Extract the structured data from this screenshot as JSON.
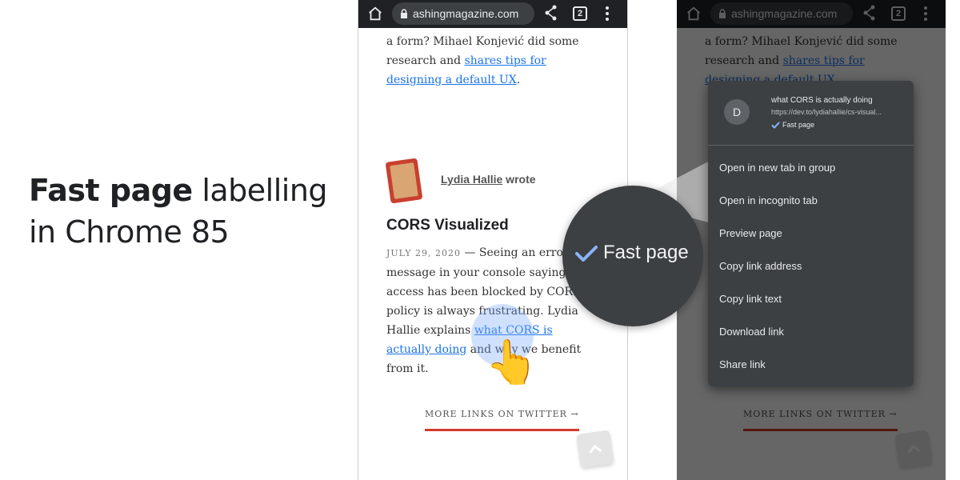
{
  "headline": {
    "bold": "Fast page",
    "rest1": "labelling",
    "rest2": "in Chrome 85"
  },
  "browser": {
    "url": "ashingmagazine.com",
    "tab_count": "2"
  },
  "article": {
    "p1_line1": "a form? Mihael Konjević did some",
    "p1_line2": "research and ",
    "p1_link": "shares tips for",
    "p1_link2": "designing a default UX",
    "p1_end": ".",
    "author_name": "Lydia Hallie",
    "author_suffix": " wrote",
    "title": "CORS Visualized",
    "date": "JULY 29, 2020",
    "body_part1": " — Seeing an error message in your console saying that access has been blocked by CORS policy is always frustrating. Lydia Hallie explains ",
    "body_link": "what CORS is actually doing",
    "body_end": " and why we benefit from it.",
    "more_links": "MORE LINKS ON TWITTER →"
  },
  "context_menu": {
    "avatar_letter": "D",
    "link_title": "what CORS is actually doing",
    "link_url": "https://dev.to/lydiahallie/cs-visual...",
    "fast_page": "Fast page",
    "items": [
      "Open in new tab in group",
      "Open in incognito tab",
      "Preview page",
      "Copy link address",
      "Copy link text",
      "Download link",
      "Share link"
    ]
  },
  "callout": {
    "label": "Fast page"
  },
  "colors": {
    "link": "#1a73e8",
    "accent_red": "#d33b2c",
    "check_blue": "#8ab4f8",
    "menu_bg": "#3c4043"
  },
  "icons": [
    "home-icon",
    "lock-icon",
    "share-icon",
    "tabs-icon",
    "more-vert-icon",
    "checkmark-icon",
    "chevron-up-icon",
    "pointing-hand-icon"
  ]
}
